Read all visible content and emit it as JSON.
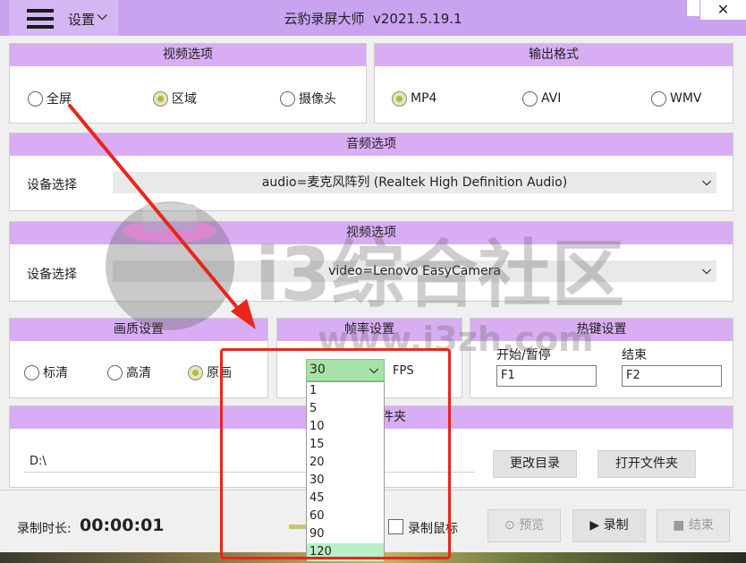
{
  "titlebar": {
    "menu_label": "设置",
    "title": "云豹录屏大师",
    "version": "v2021.5.19.1",
    "close_glyph": "✕"
  },
  "video_options": {
    "header": "视频选项",
    "radios": [
      {
        "label": "全屏",
        "selected": false
      },
      {
        "label": "区域",
        "selected": true
      },
      {
        "label": "摄像头",
        "selected": false
      }
    ]
  },
  "output_format": {
    "header": "输出格式",
    "radios": [
      {
        "label": "MP4",
        "selected": true
      },
      {
        "label": "AVI",
        "selected": false
      },
      {
        "label": "WMV",
        "selected": false
      }
    ]
  },
  "audio": {
    "header": "音频选项",
    "device_label": "设备选择",
    "device_value": "audio=麦克风阵列 (Realtek High Definition Audio)"
  },
  "video_device": {
    "header": "视频选项",
    "device_label": "设备选择",
    "device_value": "video=Lenovo EasyCamera"
  },
  "quality": {
    "header": "画质设置",
    "radios": [
      {
        "label": "标清",
        "selected": false
      },
      {
        "label": "高清",
        "selected": false
      },
      {
        "label": "原画",
        "selected": true
      }
    ]
  },
  "framerate": {
    "header": "帧率设置",
    "selected": "30",
    "unit": "FPS",
    "options": [
      "1",
      "5",
      "10",
      "15",
      "20",
      "30",
      "45",
      "60",
      "90",
      "120"
    ],
    "highlighted": "120"
  },
  "hotkeys": {
    "header": "热键设置",
    "start_pause_label": "开始/暂停",
    "start_pause_value": "F1",
    "end_label": "结束",
    "end_value": "F2"
  },
  "folder": {
    "header_visible": "件夹",
    "path": "D:\\",
    "change_dir_button": "更改目录",
    "open_folder_button": "打开文件夹"
  },
  "bottom": {
    "duration_label": "录制时长:",
    "duration_value": "00:00:01",
    "record_mouse_label": "录制鼠标",
    "preview_button": "预览",
    "record_button": "录制",
    "end_button": "结束"
  },
  "watermark": {
    "brand": "i3综合社区",
    "url": "www.i3zh.com"
  },
  "colors": {
    "titlebar": "#c9a3f0",
    "panel_header": "#d9adf3",
    "fps_select": "#a7e3a7",
    "annotation_red": "#e8261c"
  }
}
